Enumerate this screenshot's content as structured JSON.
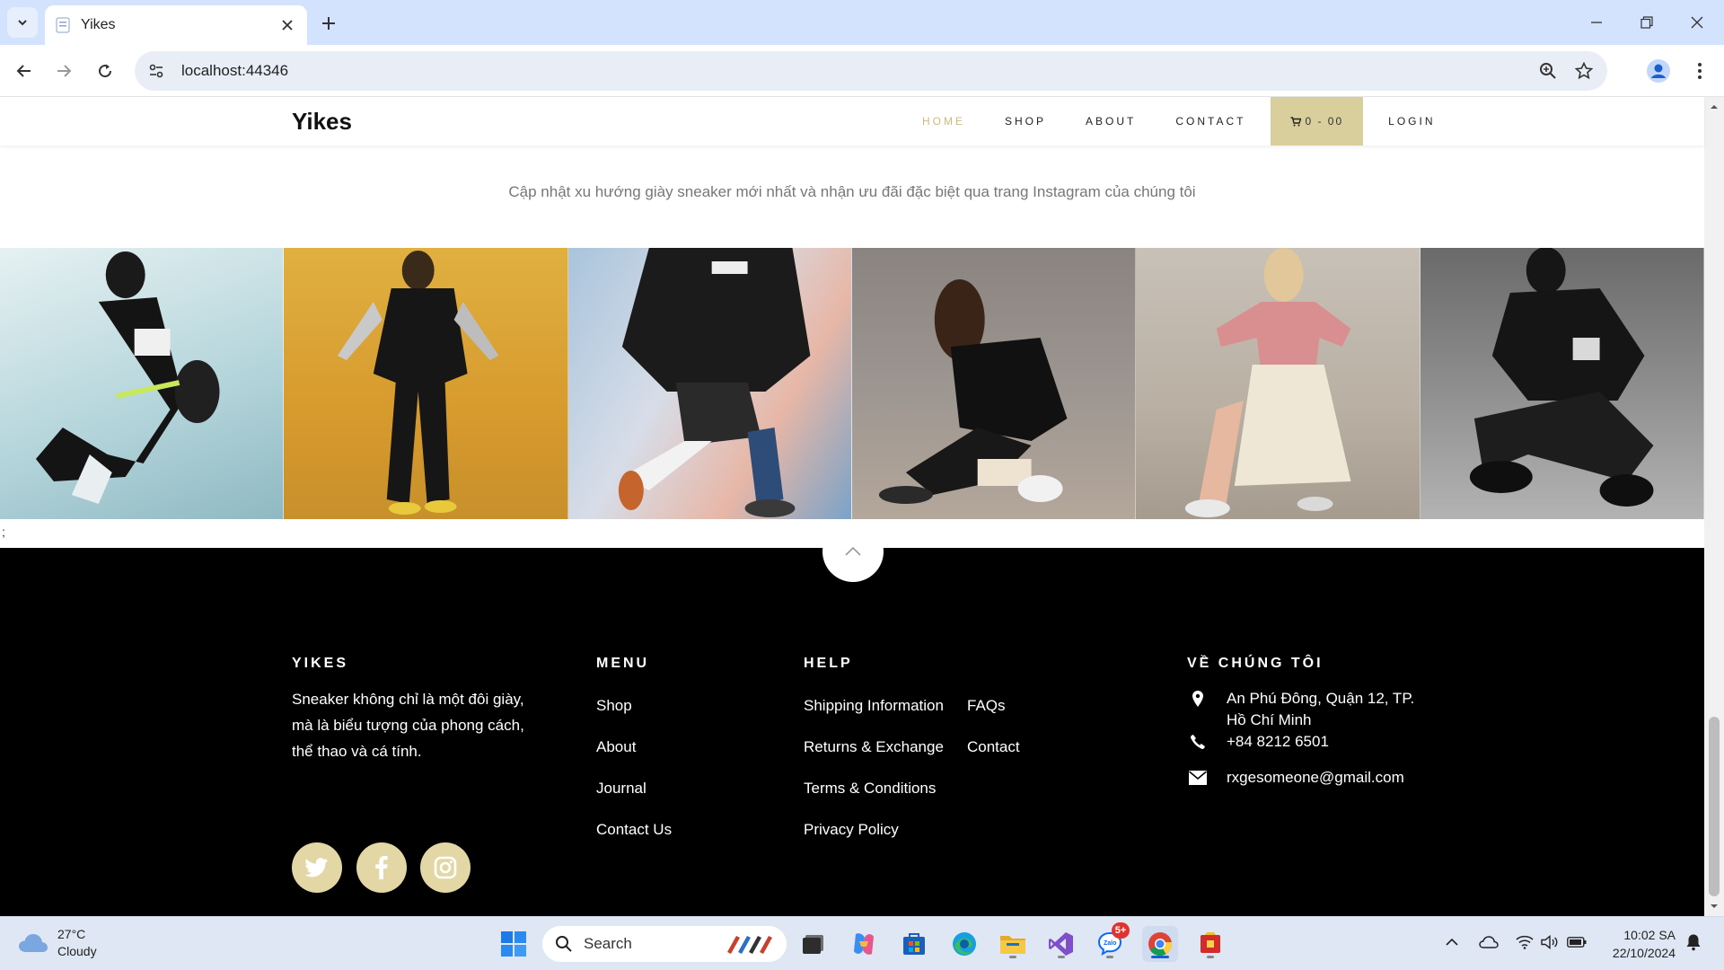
{
  "browser": {
    "tab_title": "Yikes",
    "url": "localhost:44346"
  },
  "site": {
    "brand": "Yikes",
    "nav": [
      {
        "label": "HOME",
        "active": true
      },
      {
        "label": "SHOP",
        "active": false
      },
      {
        "label": "ABOUT",
        "active": false
      },
      {
        "label": "CONTACT",
        "active": false
      }
    ],
    "cart_label": "0 - 00",
    "login_label": "LOGIN",
    "accent_color": "#cdb97f",
    "cart_color": "#d9cf9c"
  },
  "instagram": {
    "subtitle": "Cập nhật xu hướng giày sneaker mới nhất và nhận ưu đãi đặc biệt qua trang Instagram của chúng tôi",
    "photo_count": 6
  },
  "stray_text": ";",
  "footer": {
    "about": {
      "title": "YIKES",
      "lines": [
        "Sneaker không chỉ là một đôi giày,",
        "mà là biểu tượng của phong cách,",
        "thể thao và cá tính."
      ]
    },
    "menu": {
      "title": "MENU",
      "links": [
        "Shop",
        "About",
        "Journal",
        "Contact Us"
      ]
    },
    "help": {
      "title": "HELP",
      "col1": [
        "Shipping Information",
        "Returns & Exchange",
        "Terms & Conditions",
        "Privacy Policy"
      ],
      "col2": [
        "FAQs",
        "Contact"
      ]
    },
    "contact": {
      "title": "VỀ CHÚNG TÔI",
      "address_line1": "An Phú Đông, Quận 12, TP.",
      "address_line2": "Hồ Chí Minh",
      "phone": "+84 8212 6501",
      "email": "rxgesomeone@gmail.com"
    },
    "social": [
      "twitter-icon",
      "facebook-icon",
      "instagram-icon"
    ],
    "social_color": "#e3d7a5"
  },
  "taskbar": {
    "temperature": "27°C",
    "weather": "Cloudy",
    "search_placeholder": "Search",
    "time": "10:02 SA",
    "date": "22/10/2024",
    "zalo_badge": "5+"
  }
}
